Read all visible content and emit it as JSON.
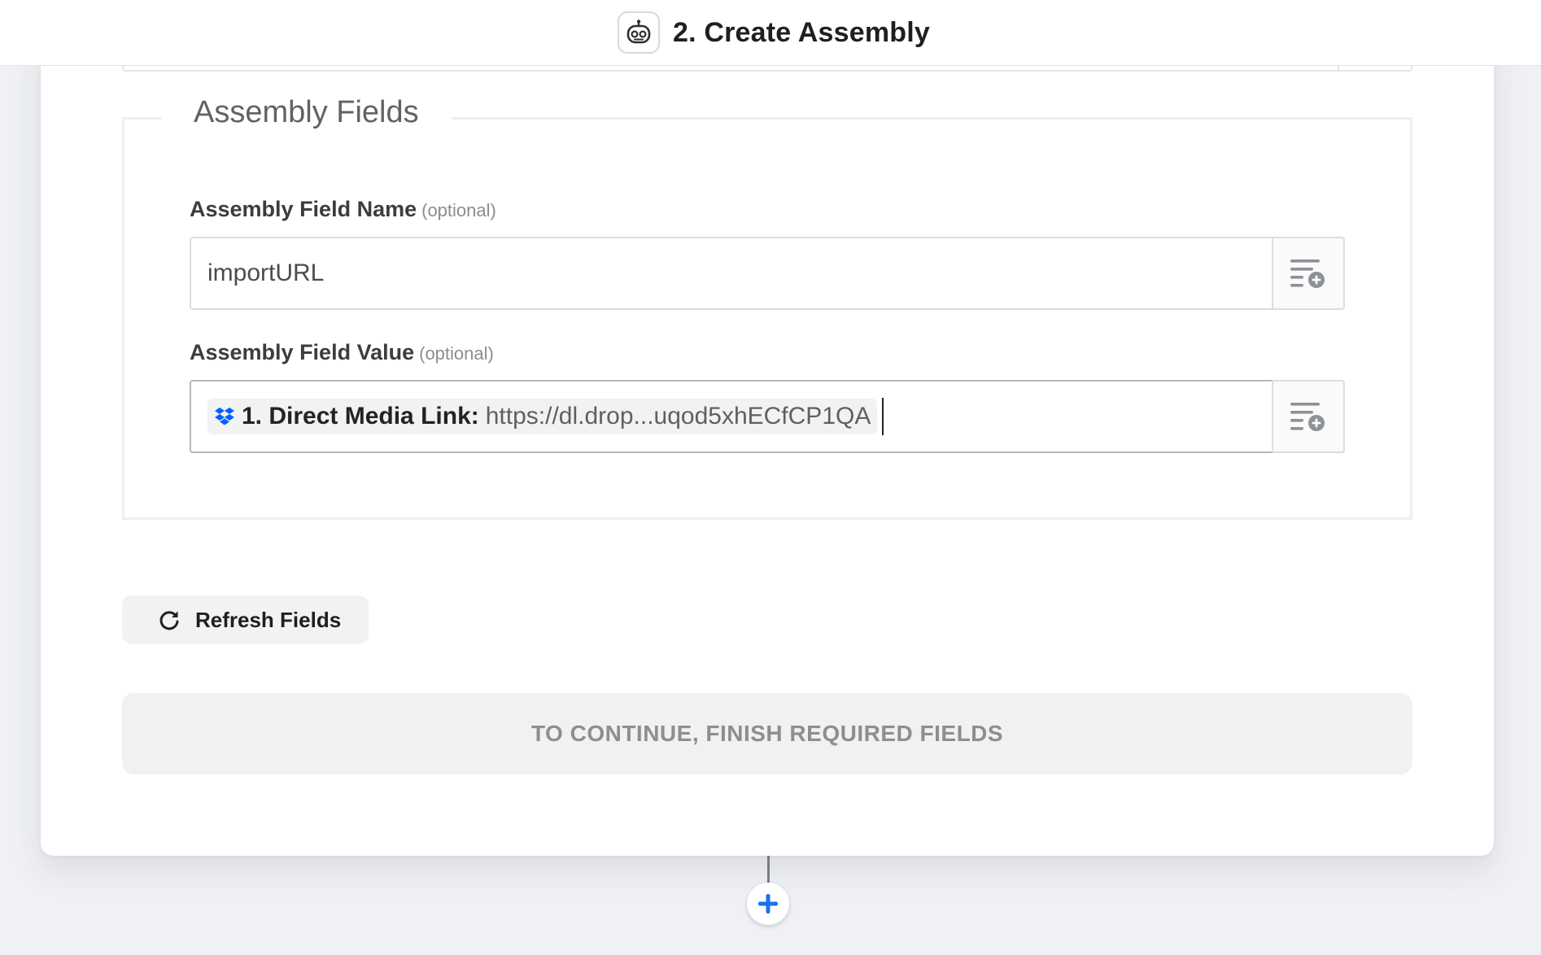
{
  "header": {
    "step_title": "2. Create Assembly",
    "app_icon": "robot-icon"
  },
  "section": {
    "legend": "Assembly Fields"
  },
  "fields": [
    {
      "label": "Assembly Field Name",
      "optional": "(optional)",
      "value": "importURL",
      "insert_icon": "insert-data-icon"
    },
    {
      "label": "Assembly Field Value",
      "optional": "(optional)",
      "pill": {
        "icon": "dropbox-icon",
        "label": "1. Direct Media Link:",
        "value": "https://dl.drop...uqod5xhECfCP1QA"
      },
      "insert_icon": "insert-data-icon"
    }
  ],
  "buttons": {
    "refresh": "Refresh Fields",
    "continue": "TO CONTINUE, FINISH REQUIRED FIELDS"
  },
  "colors": {
    "accent_blue": "#1a73e8",
    "dropbox_blue": "#0061fe",
    "disabled_text": "#8c8e91"
  }
}
